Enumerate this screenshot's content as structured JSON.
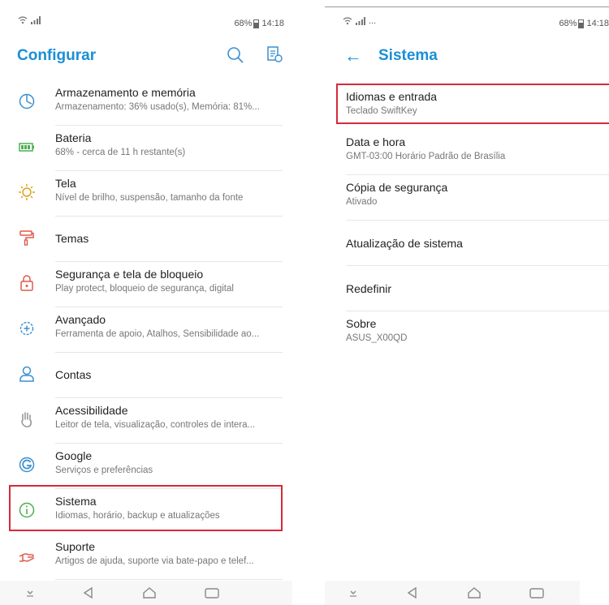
{
  "left": {
    "status": {
      "battery": "68%",
      "time": "14:18"
    },
    "title": "Configurar",
    "items": [
      {
        "title": "Armazenamento e memória",
        "subtitle": "Armazenamento: 36% usado(s), Memória: 81%..."
      },
      {
        "title": "Bateria",
        "subtitle": "68% - cerca de 11 h restante(s)"
      },
      {
        "title": "Tela",
        "subtitle": "Nível de brilho, suspensão, tamanho da fonte"
      },
      {
        "title": "Temas",
        "subtitle": ""
      },
      {
        "title": "Segurança e tela de bloqueio",
        "subtitle": "Play protect, bloqueio de segurança, digital"
      },
      {
        "title": "Avançado",
        "subtitle": "Ferramenta de apoio, Atalhos, Sensibilidade ao..."
      },
      {
        "title": "Contas",
        "subtitle": ""
      },
      {
        "title": "Acessibilidade",
        "subtitle": "Leitor de tela, visualização, controles de intera..."
      },
      {
        "title": "Google",
        "subtitle": "Serviços e preferências"
      },
      {
        "title": "Sistema",
        "subtitle": "Idiomas, horário, backup e atualizações"
      },
      {
        "title": "Suporte",
        "subtitle": "Artigos de ajuda, suporte via bate-papo e telef..."
      }
    ]
  },
  "right": {
    "status": {
      "extra": "...",
      "battery": "68%",
      "time": "14:18"
    },
    "title": "Sistema",
    "items": [
      {
        "title": "Idiomas e entrada",
        "subtitle": "Teclado SwiftKey"
      },
      {
        "title": "Data e hora",
        "subtitle": "GMT-03:00 Horário Padrão de Brasília"
      },
      {
        "title": "Cópia de segurança",
        "subtitle": "Ativado"
      },
      {
        "title": "Atualização de sistema",
        "subtitle": ""
      },
      {
        "title": "Redefinir",
        "subtitle": ""
      },
      {
        "title": "Sobre",
        "subtitle": "ASUS_X00QD"
      }
    ]
  },
  "colors": {
    "accent": "#1a8fd6",
    "highlight": "#d62a3a",
    "icon": "#3b8fd0"
  }
}
